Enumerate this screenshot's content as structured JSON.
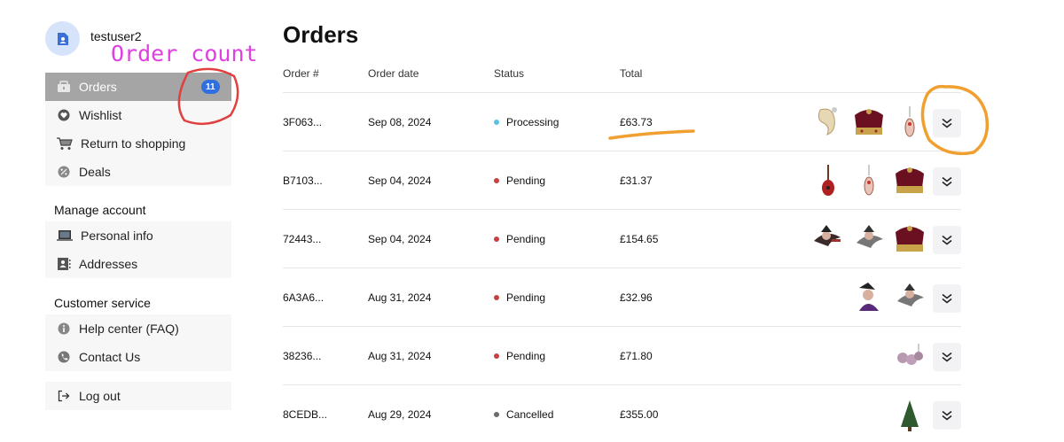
{
  "user": {
    "name": "testuser2"
  },
  "annotations": {
    "order_count_note": "Order count"
  },
  "sidebar": {
    "main_items": [
      {
        "label": "Orders",
        "badge": "11",
        "icon": "shopping-bag-icon"
      },
      {
        "label": "Wishlist",
        "icon": "heart-icon"
      },
      {
        "label": "Return to shopping",
        "icon": "cart-icon"
      },
      {
        "label": "Deals",
        "icon": "percent-icon"
      }
    ],
    "manage_title": "Manage account",
    "manage_items": [
      {
        "label": "Personal info",
        "icon": "laptop-icon"
      },
      {
        "label": "Addresses",
        "icon": "address-book-icon"
      }
    ],
    "service_title": "Customer service",
    "service_items": [
      {
        "label": "Help center (FAQ)",
        "icon": "info-icon"
      },
      {
        "label": "Contact Us",
        "icon": "phone-icon"
      }
    ],
    "logout_label": "Log out"
  },
  "main": {
    "title": "Orders",
    "columns": [
      "Order #",
      "Order date",
      "Status",
      "Total"
    ],
    "orders": [
      {
        "id": "3F063...",
        "date": "Sep 08, 2024",
        "status": "Processing",
        "total": "£63.73"
      },
      {
        "id": "B7103...",
        "date": "Sep 04, 2024",
        "status": "Pending",
        "total": "£31.37"
      },
      {
        "id": "72443...",
        "date": "Sep 04, 2024",
        "status": "Pending",
        "total": "£154.65"
      },
      {
        "id": "6A3A6...",
        "date": "Aug 31, 2024",
        "status": "Pending",
        "total": "£32.96"
      },
      {
        "id": "38236...",
        "date": "Aug 31, 2024",
        "status": "Pending",
        "total": "£71.80"
      },
      {
        "id": "8CEDB...",
        "date": "Aug 29, 2024",
        "status": "Cancelled",
        "total": "£355.00"
      }
    ]
  },
  "colors": {
    "badge": "#2f6fe0",
    "processing": "#5bc0e8",
    "pending": "#c94040",
    "cancelled": "#6b6b6b",
    "annotation_pink": "#e040e0",
    "annotation_red": "#e04040",
    "annotation_orange": "#f0a030"
  }
}
